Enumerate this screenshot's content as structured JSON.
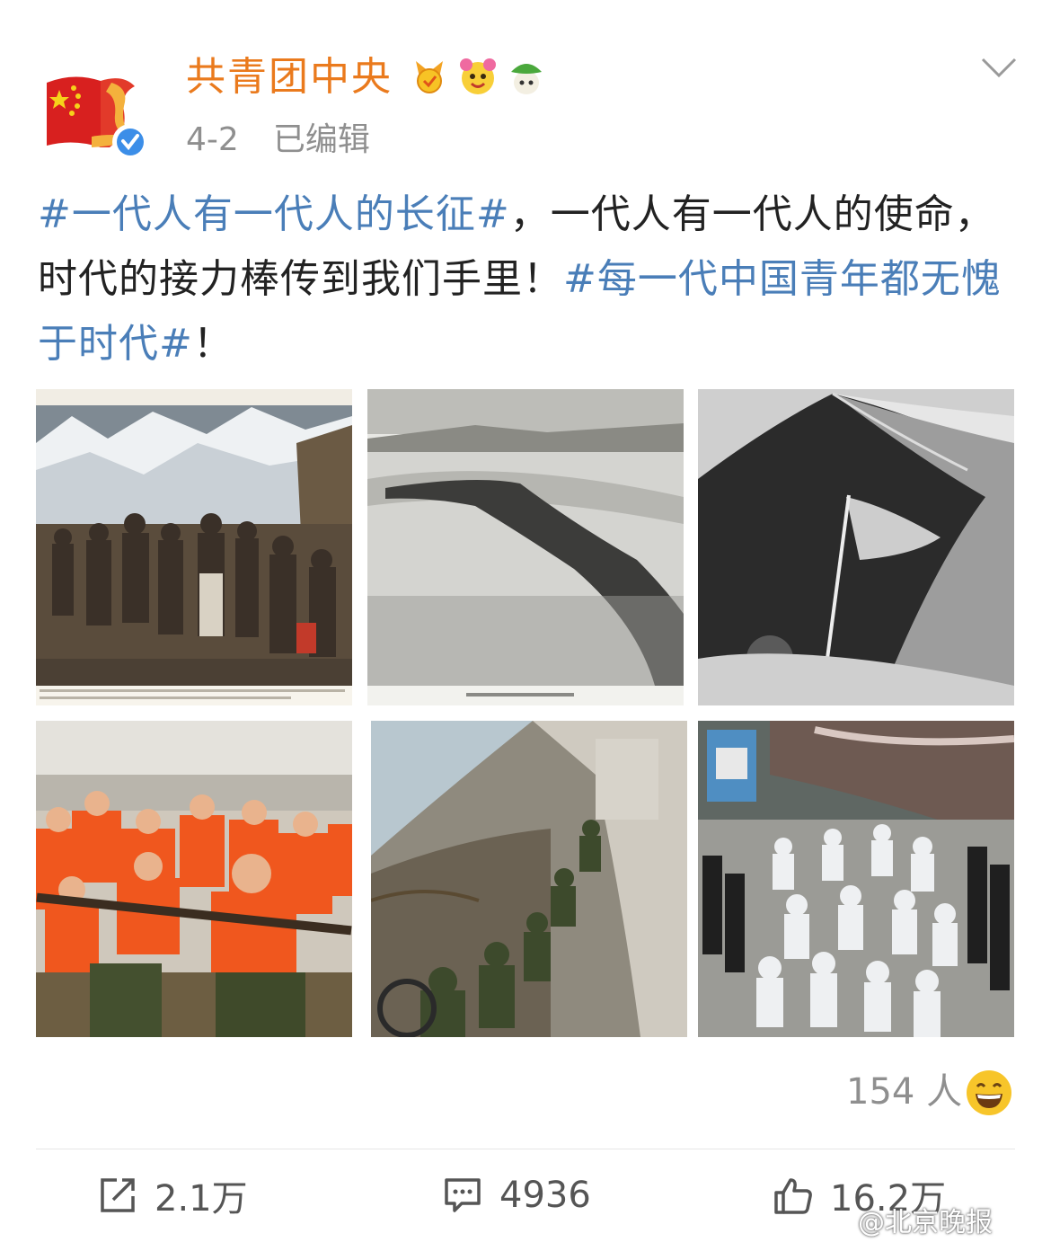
{
  "user": {
    "name": "共青团中央",
    "timestamp": "4-2",
    "edited_label": "已编辑",
    "badges": [
      "vip-medal-icon",
      "flower-emoji-icon",
      "green-sprite-icon"
    ]
  },
  "post": {
    "segments": [
      {
        "text": "#一代人有一代人的长征#",
        "type": "hashtag"
      },
      {
        "text": "，一代人有一代人的使命，时代的接力棒传到我们手里！",
        "type": "text"
      },
      {
        "text": "#每一代中国青年都无愧于时代#",
        "type": "hashtag"
      },
      {
        "text": "！",
        "type": "text"
      }
    ]
  },
  "photos": [
    {
      "name": "long-march-painting"
    },
    {
      "name": "river-crossing-photo"
    },
    {
      "name": "mountain-flag-photo"
    },
    {
      "name": "flood-rescue-photo"
    },
    {
      "name": "cliff-soldiers-photo"
    },
    {
      "name": "medical-workers-photo"
    }
  ],
  "reactions": {
    "count_label": "154 人",
    "emoji": "grin-emoji-icon"
  },
  "actions": {
    "share_count": "2.1万",
    "comment_count": "4936",
    "like_count": "16.2万"
  },
  "watermark": "@北京晚报",
  "colors": {
    "username": "#ea7a1d",
    "hashtag": "#4a7eb8",
    "meta": "#8f8f8f"
  }
}
